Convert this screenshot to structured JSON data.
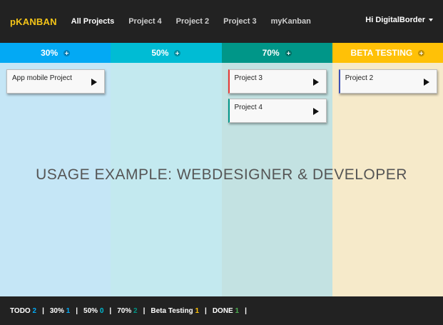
{
  "colors": {
    "brand": "#f5c518",
    "col_30": "#03a9f4",
    "col_50": "#00bcd4",
    "col_70": "#009688",
    "col_beta": "#ffc107"
  },
  "topbar": {
    "brand": "pKANBAN",
    "nav": [
      "All Projects",
      "Project 4",
      "Project 2",
      "Project 3",
      "myKanban"
    ],
    "user": "Hi DigitalBorder"
  },
  "columns": [
    {
      "title": "30%",
      "header_color": "#03a9f4",
      "body_color": "#c5e6f6",
      "cards": [
        {
          "title": "App mobile Project",
          "accent": ""
        }
      ]
    },
    {
      "title": "50%",
      "header_color": "#00bcd4",
      "body_color": "#c3e9ef",
      "cards": []
    },
    {
      "title": "70%",
      "header_color": "#009688",
      "body_color": "#c3e2e2",
      "cards": [
        {
          "title": "Project 3",
          "accent": "#e53935"
        },
        {
          "title": "Project 4",
          "accent": "#009688"
        }
      ]
    },
    {
      "title": "BETA TESTING",
      "header_color": "#ffc107",
      "body_color": "#f6eaca",
      "cards": [
        {
          "title": "Project 2",
          "accent": "#3f51b5"
        }
      ]
    }
  ],
  "overlay_text": "USAGE EXAMPLE: WEBDESIGNER & DEVELOPER",
  "footer": {
    "stats": [
      {
        "label": "TODO",
        "count": "2",
        "color": "#03a9f4"
      },
      {
        "label": "30%",
        "count": "1",
        "color": "#03a9f4"
      },
      {
        "label": "50%",
        "count": "0",
        "color": "#00bcd4"
      },
      {
        "label": "70%",
        "count": "2",
        "color": "#009688"
      },
      {
        "label": "Beta Testing",
        "count": "1",
        "color": "#ffc107"
      },
      {
        "label": "DONE",
        "count": "1",
        "color": "#4caf50"
      }
    ],
    "separator": "|"
  }
}
